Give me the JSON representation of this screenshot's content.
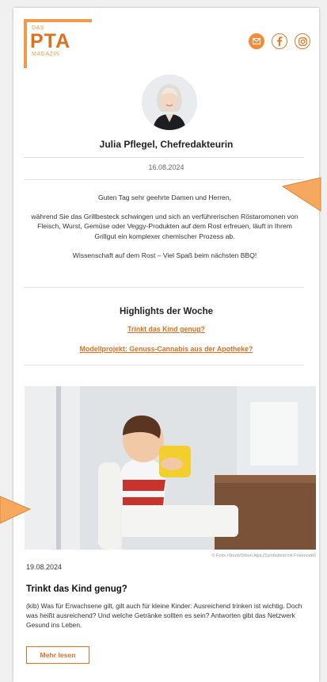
{
  "header": {
    "logo": {
      "das": "DAS",
      "pta": "PTA",
      "magazin": "MAGAZIN"
    },
    "social_icons": [
      "mail-icon",
      "facebook-icon",
      "instagram-icon"
    ]
  },
  "editor": {
    "name": "Julia Pflegel, Chefredakteurin",
    "date": "16.08.2024"
  },
  "intro": {
    "greeting": "Guten Tag sehr geehrte Damen und Herren,",
    "body": "während Sie das Grillbesteck schwingen und sich an verführerischen Röstaromonen von Fleisch, Wurst, Gemüse oder Veggy-Produkten auf dem Rost erfreuen, läuft in Ihrem Grillgut ein komplexer chemischer Prozess ab.",
    "closing": "Wissenschaft auf dem Rost – Viel Spaß beim nächsten BBQ!"
  },
  "highlights": {
    "title": "Highlights der Woche",
    "links": [
      "Trinkt das Kind genug?",
      "Modellprojekt: Genuss-Cannabis aus der Apotheke?"
    ]
  },
  "article": {
    "credit": "© Foto: iStock/Orbon Alija (Symbolbild mit Fotomodel)",
    "date": "19.08.2024",
    "title": "Trinkt das Kind genug?",
    "text": "(kib) Was für Erwachsene gilt, gilt auch für kleine Kinder: Ausreichend trinken ist wichtig. Doch was heißt ausreichend? Und welche Getränke sollten es sein? Antworten gibt das Netzwerk Gesund ins Leben.",
    "more_label": "Mehr lesen"
  },
  "colors": {
    "accent": "#e0701f",
    "arrow": "#f5a85e"
  }
}
